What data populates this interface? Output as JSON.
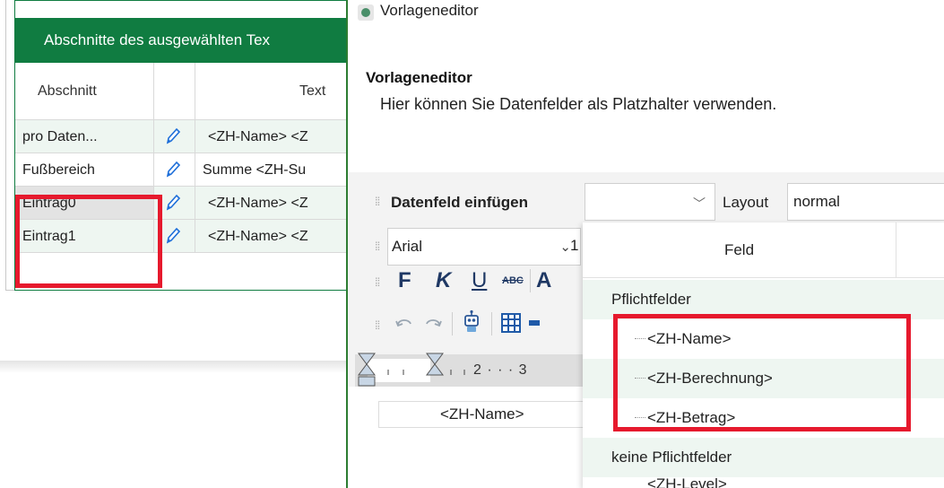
{
  "left_grid": {
    "header_title": "Abschnitte des ausgewählten Tex",
    "columns": [
      "Abschnitt",
      "",
      "Text"
    ],
    "rows": [
      {
        "abschnitt": "pro Daten...",
        "text": "<ZH-Name> <Z"
      },
      {
        "abschnitt": "Fußbereich",
        "text": "Summe <ZH-Su"
      },
      {
        "abschnitt": "Eintrag0",
        "text": "<ZH-Name> <Z"
      },
      {
        "abschnitt": "Eintrag1",
        "text": "<ZH-Name> <Z"
      }
    ]
  },
  "editor": {
    "window_title": "Vorlageneditor",
    "header_title": "Vorlageneditor",
    "header_subtitle": "Hier können Sie Datenfelder als Platzhalter verwenden.",
    "toolbar": {
      "insert_field_label": "Datenfeld einfügen",
      "insert_field_value": "",
      "layout_label": "Layout",
      "layout_value": "normal",
      "font_value": "Arial",
      "font_size_value": "1",
      "bold_label": "F",
      "italic_label": "K",
      "underline_label": "U",
      "strike_label": "ABC",
      "font_color_label": "A"
    },
    "ruler_numbers": "2 · · · 3",
    "document_cell_text": "<ZH-Name>"
  },
  "field_popup": {
    "column_header": "Feld",
    "groups": [
      {
        "label": "Pflichtfelder",
        "items": [
          "<ZH-Name>",
          "<ZH-Berechnung>",
          "<ZH-Betrag>"
        ]
      },
      {
        "label": "keine Pflichtfelder",
        "items": [
          "<ZH-Level>"
        ]
      }
    ]
  },
  "colors": {
    "accent_green": "#107c41",
    "highlight_red": "#e6192d",
    "row_tint": "#eef6f1"
  }
}
